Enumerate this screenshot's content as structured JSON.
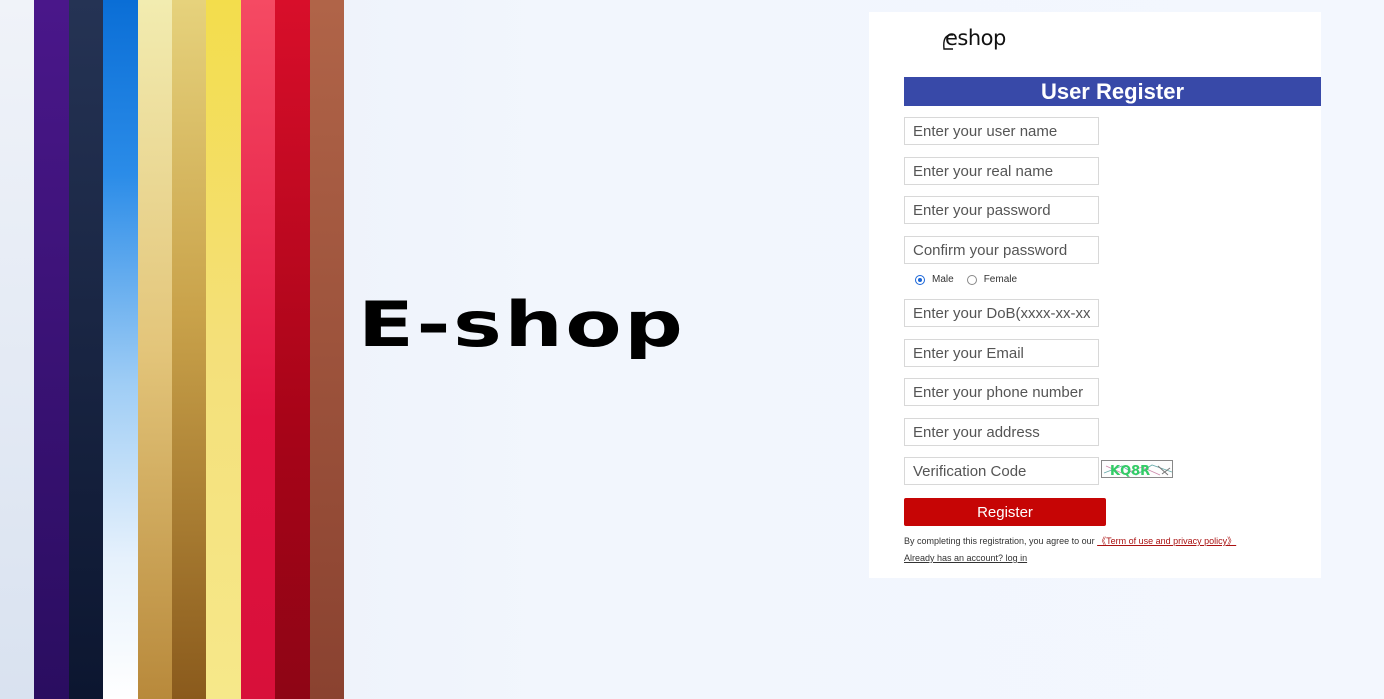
{
  "brand": {
    "big_title": "E-shop",
    "logo_text": "eshop"
  },
  "stripe_colors": [
    "#e4e9f3",
    "#3a1277",
    "#1a2440",
    "#0a6ed6",
    "#e9dd8e",
    "#c9a24a",
    "#f2d650",
    "#f04a5f",
    "#d01028",
    "#9a5038"
  ],
  "form": {
    "title": "User Register",
    "fields": {
      "username": "Enter your user name",
      "realname": "Enter your real name",
      "password": "Enter your password",
      "confirm": "Confirm your password",
      "dob": "Enter your DoB(xxxx-xx-xx)",
      "email": "Enter your Email",
      "phone": "Enter your phone number",
      "address": "Enter your address",
      "verification": "Verification Code"
    },
    "gender": {
      "male": "Male",
      "female": "Female",
      "selected": "Male"
    },
    "captcha_text": "KQ8R",
    "register_label": "Register",
    "terms_prefix": "By completing this registration, you agree to our",
    "terms_link": "《Term of use and privacy policy》",
    "login_link": "Already has an account? log in"
  },
  "colors": {
    "header": "#3849a8",
    "register": "#c60505",
    "link": "#a11111"
  }
}
